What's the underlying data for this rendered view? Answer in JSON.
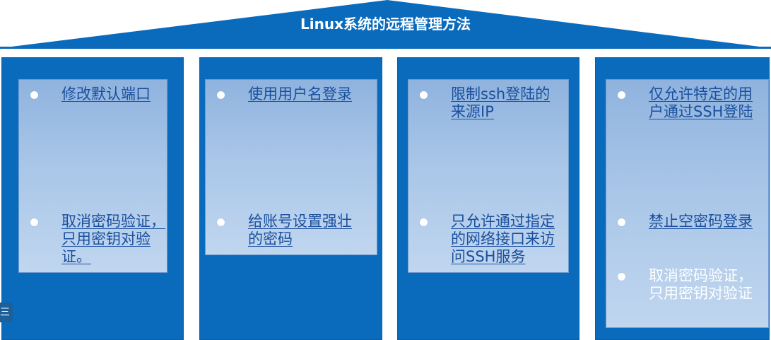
{
  "title": "Linux系统的远程管理方法",
  "colors": {
    "roof": "#0a6bbd",
    "pillar": "#0a6bbd",
    "panel_top": "#8fb3de",
    "panel_bottom": "#c0d6ef",
    "link_text": "#1a4f9e",
    "plain_text": "#ffffff"
  },
  "side_badge": {
    "icon": "menu-icon",
    "glyph": "三"
  },
  "pillars": [
    {
      "items": [
        {
          "lines": [
            "修改默认端口"
          ],
          "style": "link"
        },
        {
          "lines": [
            "取消密码验证，",
            "只用密钥对验",
            "证。"
          ],
          "style": "link"
        }
      ]
    },
    {
      "items": [
        {
          "lines": [
            "使用用户名登录"
          ],
          "style": "link"
        },
        {
          "lines": [
            "给账号设置强壮",
            "的密码"
          ],
          "style": "link"
        }
      ]
    },
    {
      "items": [
        {
          "lines": [
            "限制ssh登陆的",
            "来源IP"
          ],
          "style": "link"
        },
        {
          "lines": [
            "只允许通过指定",
            "的网络接口来访",
            "问SSH服务"
          ],
          "style": "link"
        }
      ]
    },
    {
      "items": [
        {
          "lines": [
            "仅允许特定的用",
            "户通过SSH登陆"
          ],
          "style": "link"
        },
        {
          "lines": [
            "禁止空密码登录"
          ],
          "style": "link"
        },
        {
          "lines": [
            "取消密码验证，",
            "只用密钥对验证"
          ],
          "style": "plain"
        }
      ]
    }
  ]
}
